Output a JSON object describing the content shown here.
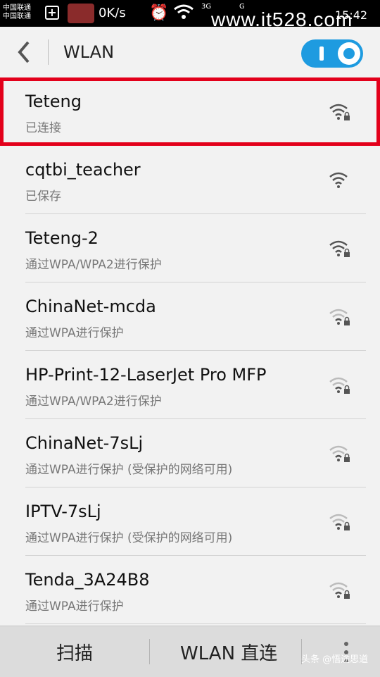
{
  "status_bar": {
    "carrier_1": "中国联通",
    "carrier_2": "中国联通",
    "speed": "0K/s",
    "network_a": "3G",
    "network_b": "G",
    "time": "15:42"
  },
  "watermark": "www.it528.com",
  "header": {
    "back_icon": "chevron-left-icon",
    "title": "WLAN",
    "toggle_on": true
  },
  "networks": [
    {
      "name": "Teteng",
      "status": "已连接",
      "signal": "strong",
      "locked": true,
      "highlighted": true
    },
    {
      "name": "cqtbi_teacher",
      "status": "已保存",
      "signal": "strong",
      "locked": false,
      "highlighted": false
    },
    {
      "name": "Teteng-2",
      "status": "通过WPA/WPA2进行保护",
      "signal": "strong",
      "locked": true,
      "highlighted": false
    },
    {
      "name": "ChinaNet-mcda",
      "status": "通过WPA进行保护",
      "signal": "weak",
      "locked": true,
      "highlighted": false
    },
    {
      "name": "HP-Print-12-LaserJet Pro MFP",
      "status": "通过WPA/WPA2进行保护",
      "signal": "weak",
      "locked": true,
      "highlighted": false
    },
    {
      "name": "ChinaNet-7sLj",
      "status": "通过WPA进行保护 (受保护的网络可用)",
      "signal": "weak",
      "locked": true,
      "highlighted": false
    },
    {
      "name": "IPTV-7sLj",
      "status": "通过WPA进行保护 (受保护的网络可用)",
      "signal": "weak",
      "locked": true,
      "highlighted": false
    },
    {
      "name": "Tenda_3A24B8",
      "status": "通过WPA进行保护",
      "signal": "weak",
      "locked": true,
      "highlighted": false
    }
  ],
  "bottom_bar": {
    "scan_label": "扫描",
    "direct_label": "WLAN 直连",
    "menu_icon": "more-vertical-icon"
  },
  "credit": "头条 @悟途思道",
  "colors": {
    "accent": "#1e9be0",
    "highlight": "#e3001b"
  }
}
